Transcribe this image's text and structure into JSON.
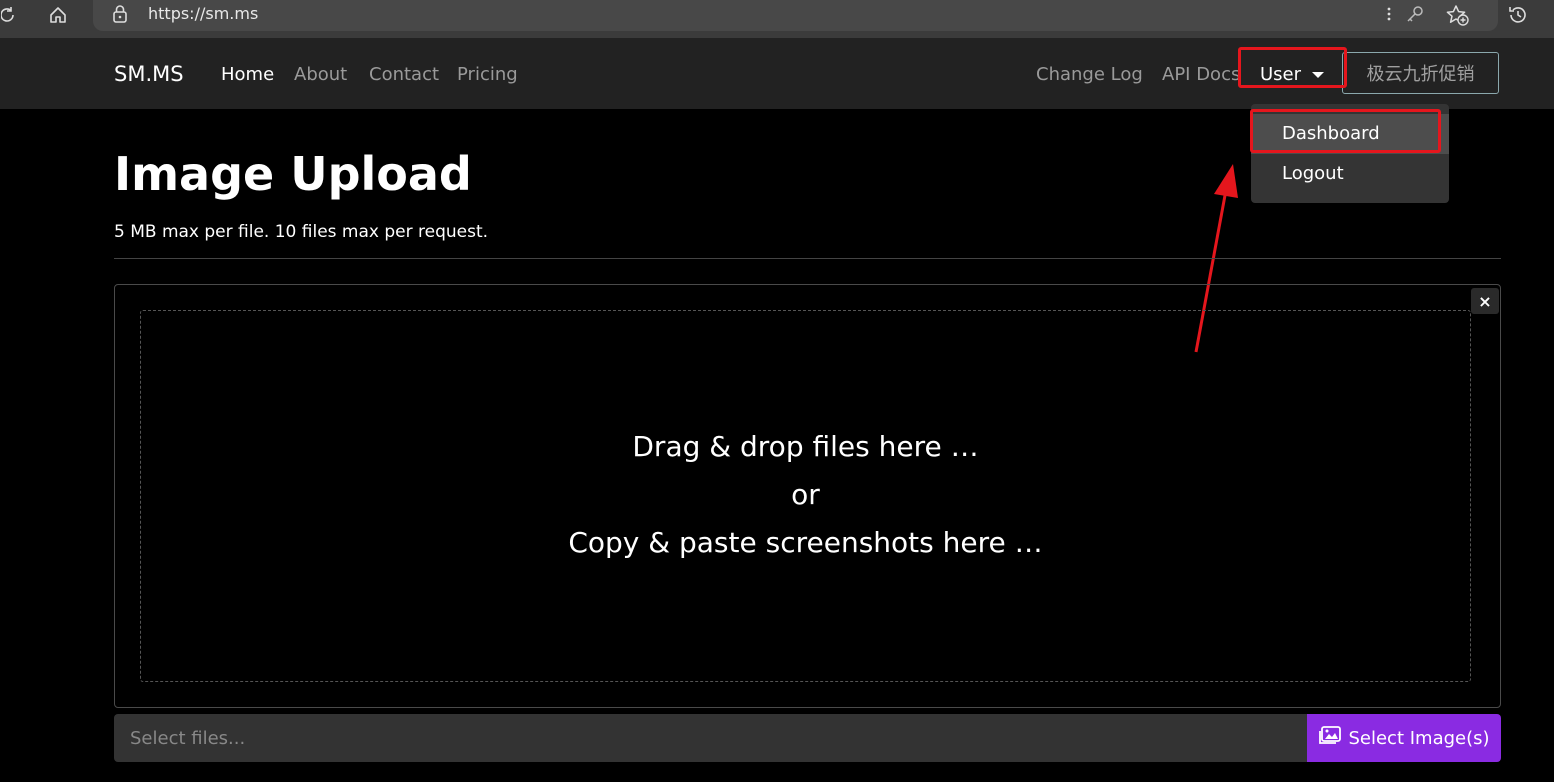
{
  "browser": {
    "url": "https://sm.ms"
  },
  "navbar": {
    "brand": "SM.MS",
    "links": [
      "Home",
      "About",
      "Contact",
      "Pricing"
    ],
    "right_links": [
      "Change Log",
      "API Docs"
    ],
    "user_label": "User",
    "promo_label": "极云九折促销"
  },
  "dropdown": {
    "items": [
      "Dashboard",
      "Logout"
    ]
  },
  "main": {
    "title": "Image Upload",
    "subtitle": "5 MB max per file. 10 files max per request.",
    "drop_line1": "Drag & drop files here …",
    "drop_line2": "or",
    "drop_line3": "Copy & paste screenshots here …",
    "close_label": "×",
    "file_placeholder": "Select files...",
    "select_label": "Select Image(s)"
  },
  "colors": {
    "accent": "#8a2be2",
    "annotation": "#e5161d"
  }
}
